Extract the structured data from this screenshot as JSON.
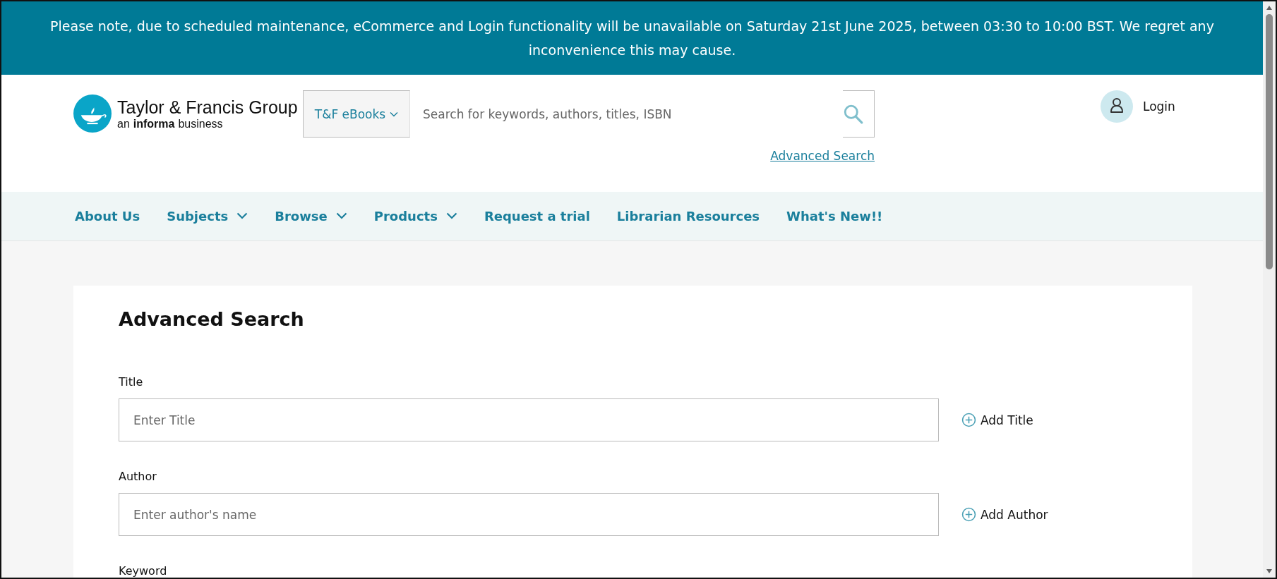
{
  "banner": {
    "text": "Please note, due to scheduled maintenance, eCommerce and Login functionality will be unavailable on Saturday 21st June 2025, between 03:30 to 10:00 BST. We regret any inconvenience this may cause."
  },
  "header": {
    "logo": {
      "name": "Taylor & Francis Group",
      "tagline_prefix": "an",
      "tagline_bold": "informa",
      "tagline_suffix": "business"
    },
    "search": {
      "scope": "T&F eBooks",
      "placeholder": "Search for keywords, authors, titles, ISBN"
    },
    "advanced_link": "Advanced Search",
    "login": "Login"
  },
  "nav": [
    {
      "label": "About Us",
      "dropdown": false
    },
    {
      "label": "Subjects",
      "dropdown": true
    },
    {
      "label": "Browse",
      "dropdown": true
    },
    {
      "label": "Products",
      "dropdown": true
    },
    {
      "label": "Request a trial",
      "dropdown": false
    },
    {
      "label": "Librarian Resources",
      "dropdown": false
    },
    {
      "label": "What's New!!",
      "dropdown": false
    }
  ],
  "form": {
    "title": "Advanced Search",
    "fields": [
      {
        "label": "Title",
        "placeholder": "Enter Title",
        "add": "Add Title"
      },
      {
        "label": "Author",
        "placeholder": "Enter author's name",
        "add": "Add Author"
      }
    ],
    "next_label": "Keyword"
  }
}
